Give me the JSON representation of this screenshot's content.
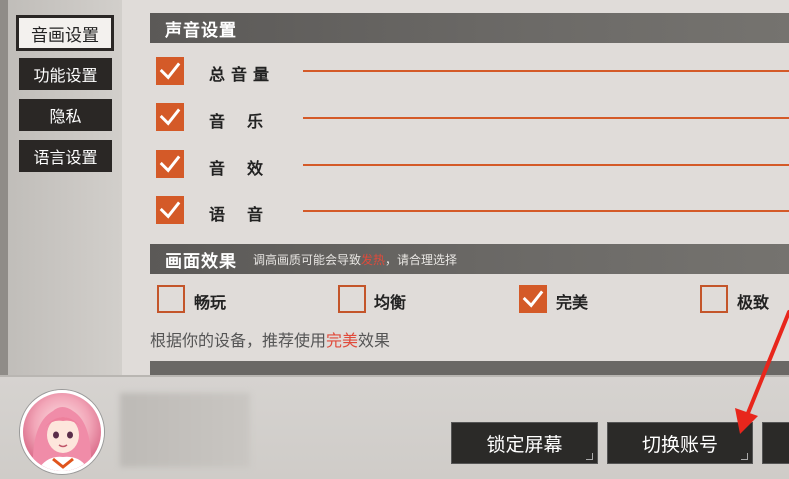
{
  "sidebar": {
    "tabs": [
      {
        "label": "音画设置",
        "active": true
      },
      {
        "label": "功能设置",
        "active": false
      },
      {
        "label": "隐私",
        "active": false
      },
      {
        "label": "语言设置",
        "active": false
      }
    ]
  },
  "sound": {
    "title": "声音设置",
    "items": [
      {
        "label": "总音量",
        "checked": true
      },
      {
        "label": "音乐",
        "checked": true
      },
      {
        "label": "音效",
        "checked": true
      },
      {
        "label": "语音",
        "checked": true
      }
    ]
  },
  "quality": {
    "title": "画面效果",
    "hint_prefix": "调高画质可能会导致",
    "hint_warn": "发热",
    "hint_suffix": "，请合理选择",
    "options": [
      {
        "label": "畅玩",
        "checked": false
      },
      {
        "label": "均衡",
        "checked": false
      },
      {
        "label": "完美",
        "checked": true
      },
      {
        "label": "极致",
        "checked": false
      }
    ],
    "recommend_prefix": "根据你的设备，推荐使用",
    "recommend_value": "完美",
    "recommend_suffix": "效果"
  },
  "bottom": {
    "lock_screen_label": "锁定屏幕",
    "switch_account_label": "切换账号"
  },
  "colors": {
    "accent": "#d45a28",
    "warn": "#e04a3a",
    "annotation_arrow": "#e8261c"
  }
}
